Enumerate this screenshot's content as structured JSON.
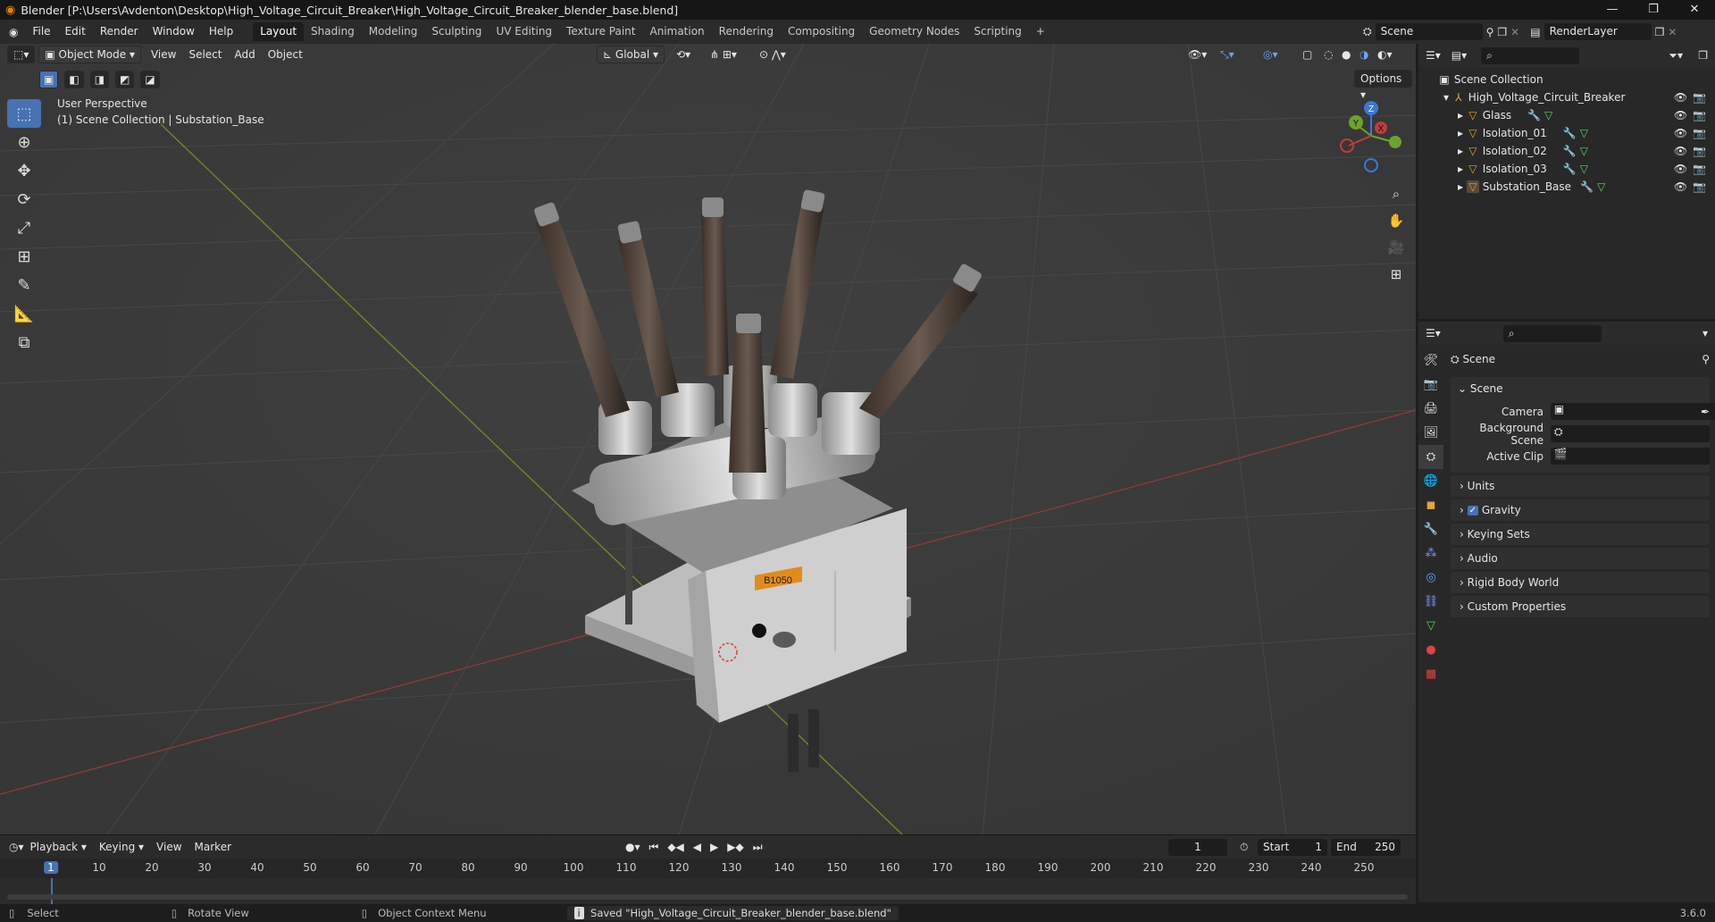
{
  "window": {
    "title": "Blender [P:\\Users\\Avdenton\\Desktop\\High_Voltage_Circuit_Breaker\\High_Voltage_Circuit_Breaker_blender_base.blend]",
    "min": "—",
    "max": "❐",
    "close": "✕"
  },
  "menu": [
    "File",
    "Edit",
    "Render",
    "Window",
    "Help"
  ],
  "tabs": [
    "Layout",
    "Shading",
    "Modeling",
    "Sculpting",
    "UV Editing",
    "Texture Paint",
    "Animation",
    "Rendering",
    "Compositing",
    "Geometry Nodes",
    "Scripting",
    "+"
  ],
  "scene_field": "Scene",
  "renderlayer_field": "RenderLayer",
  "viewport": {
    "mode": "Object Mode",
    "menus": [
      "View",
      "Select",
      "Add",
      "Object"
    ],
    "orientation": "Global",
    "options": "Options",
    "info_line1": "User Perspective",
    "info_line2": "(1) Scene Collection | Substation_Base",
    "label_box": "B1050"
  },
  "gizmo": {
    "x": "X",
    "y": "Y",
    "z": "Z"
  },
  "outliner": {
    "root": "Scene Collection",
    "collection": "High_Voltage_Circuit_Breaker",
    "items": [
      "Glass",
      "Isolation_01",
      "Isolation_02",
      "Isolation_03",
      "Substation_Base"
    ]
  },
  "properties": {
    "header": "Scene",
    "section": "Scene",
    "camera_label": "Camera",
    "bg_label": "Background Scene",
    "clip_label": "Active Clip",
    "panels": [
      "Units",
      "Gravity",
      "Keying Sets",
      "Audio",
      "Rigid Body World",
      "Custom Properties"
    ]
  },
  "timeline": {
    "menus": [
      "Playback",
      "Keying",
      "View",
      "Marker"
    ],
    "current": "1",
    "start_label": "Start",
    "start": "1",
    "end_label": "End",
    "end": "250",
    "ticks": [
      "1",
      "10",
      "20",
      "30",
      "40",
      "50",
      "60",
      "70",
      "80",
      "90",
      "100",
      "110",
      "120",
      "130",
      "140",
      "150",
      "160",
      "170",
      "180",
      "190",
      "200",
      "210",
      "220",
      "230",
      "240",
      "250"
    ]
  },
  "status": {
    "select": "Select",
    "rotate": "Rotate View",
    "context": "Object Context Menu",
    "saved": "Saved \"High_Voltage_Circuit_Breaker_blender_base.blend\"",
    "version": "3.6.0"
  }
}
